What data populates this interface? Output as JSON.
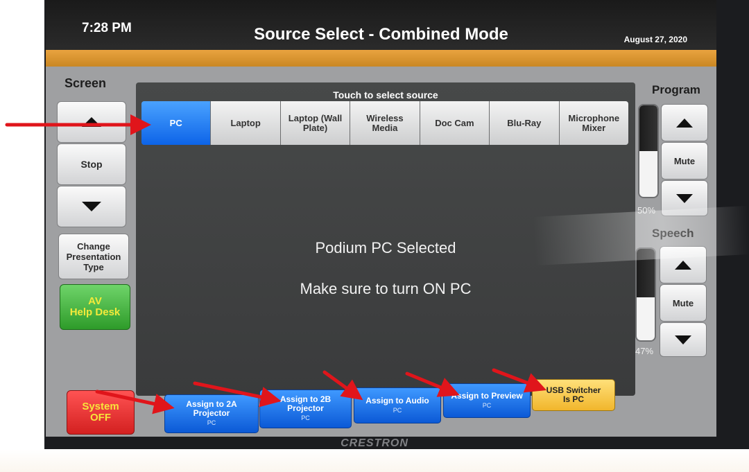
{
  "header": {
    "time": "7:28 PM",
    "title": "Source Select - Combined Mode",
    "date": "August 27, 2020"
  },
  "screen_controls": {
    "label": "Screen",
    "stop_label": "Stop",
    "up_icon": "triangle-up-icon",
    "down_icon": "triangle-down-icon"
  },
  "change_presentation": "Change Presentation Type",
  "help_desk": {
    "line1": "AV",
    "line2": "Help Desk"
  },
  "system_off": {
    "line1": "System",
    "line2": "OFF"
  },
  "sources": {
    "header": "Touch to select source",
    "selected": "PC",
    "items": [
      {
        "label": "PC",
        "active": true
      },
      {
        "label": "Laptop",
        "active": false
      },
      {
        "label": "Laptop (Wall Plate)",
        "active": false
      },
      {
        "label": "Wireless Media",
        "active": false
      },
      {
        "label": "Doc Cam",
        "active": false
      },
      {
        "label": "Blu-Ray",
        "active": false
      },
      {
        "label": "Microphone Mixer",
        "active": false
      }
    ]
  },
  "message": {
    "line1": "Podium PC Selected",
    "line2": "Make sure to turn ON PC"
  },
  "program": {
    "label": "Program",
    "level_text": "50%",
    "level": 0.5,
    "mute_label": "Mute"
  },
  "speech": {
    "label": "Speech",
    "level_text": "47%",
    "level": 0.47,
    "mute_label": "Mute"
  },
  "assign": [
    {
      "label": "Assign to 2A Projector",
      "sub": "PC"
    },
    {
      "label": "Assign to 2B Projector",
      "sub": "PC"
    },
    {
      "label": "Assign to Audio",
      "sub": "PC"
    },
    {
      "label": "Assign to Preview",
      "sub": "PC"
    }
  ],
  "usb_switcher": "USB Switcher Is PC",
  "brand": "CRESTRON",
  "colors": {
    "active_blue": "#1f7bf2",
    "assign_blue": "#1468e6",
    "green": "#3fb23a",
    "red": "#e52b2b",
    "yellow": "#f7c849",
    "orange_band": "#dc972f",
    "annotation_arrow": "#e0151b"
  }
}
